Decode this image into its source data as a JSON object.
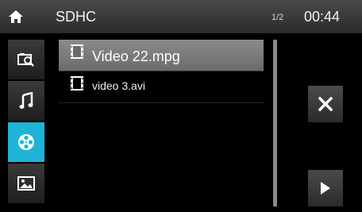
{
  "header": {
    "home_icon": "home-icon",
    "source": "SDHC",
    "page": "1/2",
    "time": "00:44"
  },
  "sidebar": {
    "items": [
      {
        "icon": "photo-browse-icon",
        "active": false
      },
      {
        "icon": "music-note-icon",
        "active": false
      },
      {
        "icon": "film-reel-icon",
        "active": true
      },
      {
        "icon": "picture-icon",
        "active": false
      }
    ],
    "active_color": "#1fb3d7"
  },
  "files": [
    {
      "name": "Video 22.mpg",
      "icon": "video-file-icon",
      "selected": true
    },
    {
      "name": "video 3.avi",
      "icon": "video-file-icon",
      "selected": false
    }
  ],
  "actions": {
    "delete_icon": "close-icon",
    "play_icon": "play-icon"
  }
}
